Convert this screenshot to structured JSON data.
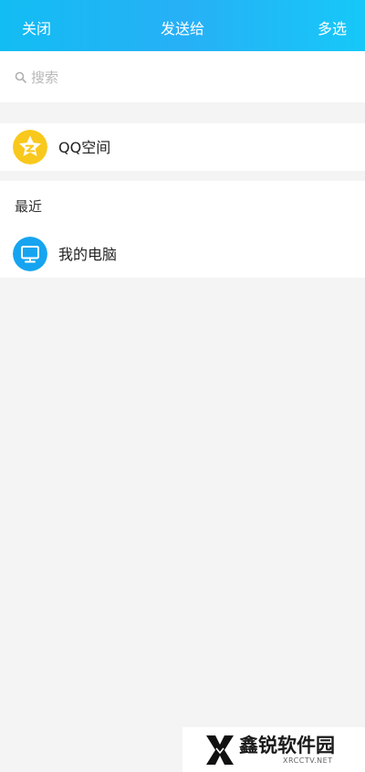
{
  "header": {
    "close_label": "关闭",
    "title": "发送给",
    "multi_select_label": "多选",
    "background_colors": [
      "#12bdf3",
      "#27b0f6",
      "#16c8f8"
    ]
  },
  "search": {
    "icon": "search-icon",
    "placeholder": "搜索"
  },
  "qzone": {
    "label": "QQ空间",
    "icon": "qzone-star-icon",
    "icon_color": "#f9c81c"
  },
  "recent": {
    "title": "最近",
    "items": [
      {
        "label": "我的电脑",
        "icon": "monitor-icon",
        "icon_color": "#16a4f0"
      }
    ]
  },
  "watermark": {
    "name": "鑫锐软件园",
    "site": "XRCCTV.NET"
  }
}
